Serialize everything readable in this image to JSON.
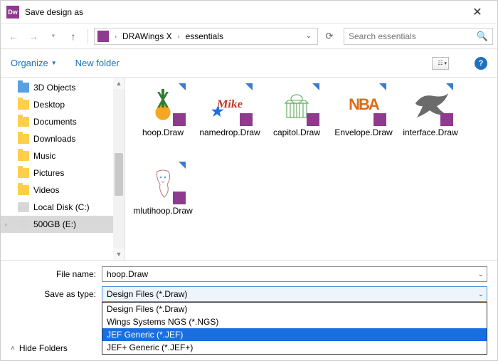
{
  "window": {
    "title": "Save design as"
  },
  "nav": {
    "crumb1": "DRAWings X",
    "crumb2": "essentials",
    "search_placeholder": "Search essentials"
  },
  "toolbar": {
    "organize": "Organize",
    "new_folder": "New folder"
  },
  "sidebar": {
    "items": [
      {
        "label": "3D Objects",
        "kind": "obj"
      },
      {
        "label": "Desktop",
        "kind": "folder"
      },
      {
        "label": "Documents",
        "kind": "folder"
      },
      {
        "label": "Downloads",
        "kind": "folder"
      },
      {
        "label": "Music",
        "kind": "folder"
      },
      {
        "label": "Pictures",
        "kind": "folder"
      },
      {
        "label": "Videos",
        "kind": "folder"
      },
      {
        "label": "Local Disk (C:)",
        "kind": "disk"
      },
      {
        "label": "500GB (E:)",
        "kind": "disk",
        "selected": true
      }
    ]
  },
  "files": [
    {
      "label": "hoop.Draw"
    },
    {
      "label": "namedrop.Draw"
    },
    {
      "label": "capitol.Draw"
    },
    {
      "label": "Envelope.Draw"
    },
    {
      "label": "interface.Draw"
    },
    {
      "label": "mlutihoop.Draw"
    }
  ],
  "form": {
    "filename_label": "File name:",
    "filename_value": "hoop.Draw",
    "type_label": "Save as type:",
    "type_value": "Design Files (*.Draw)"
  },
  "type_options": [
    "Design Files (*.Draw)",
    "Wings Systems NGS (*.NGS)",
    "JEF Generic (*.JEF)",
    "JEF+ Generic (*.JEF+)"
  ],
  "type_highlight_index": 2,
  "footer": {
    "hide": "Hide Folders"
  }
}
